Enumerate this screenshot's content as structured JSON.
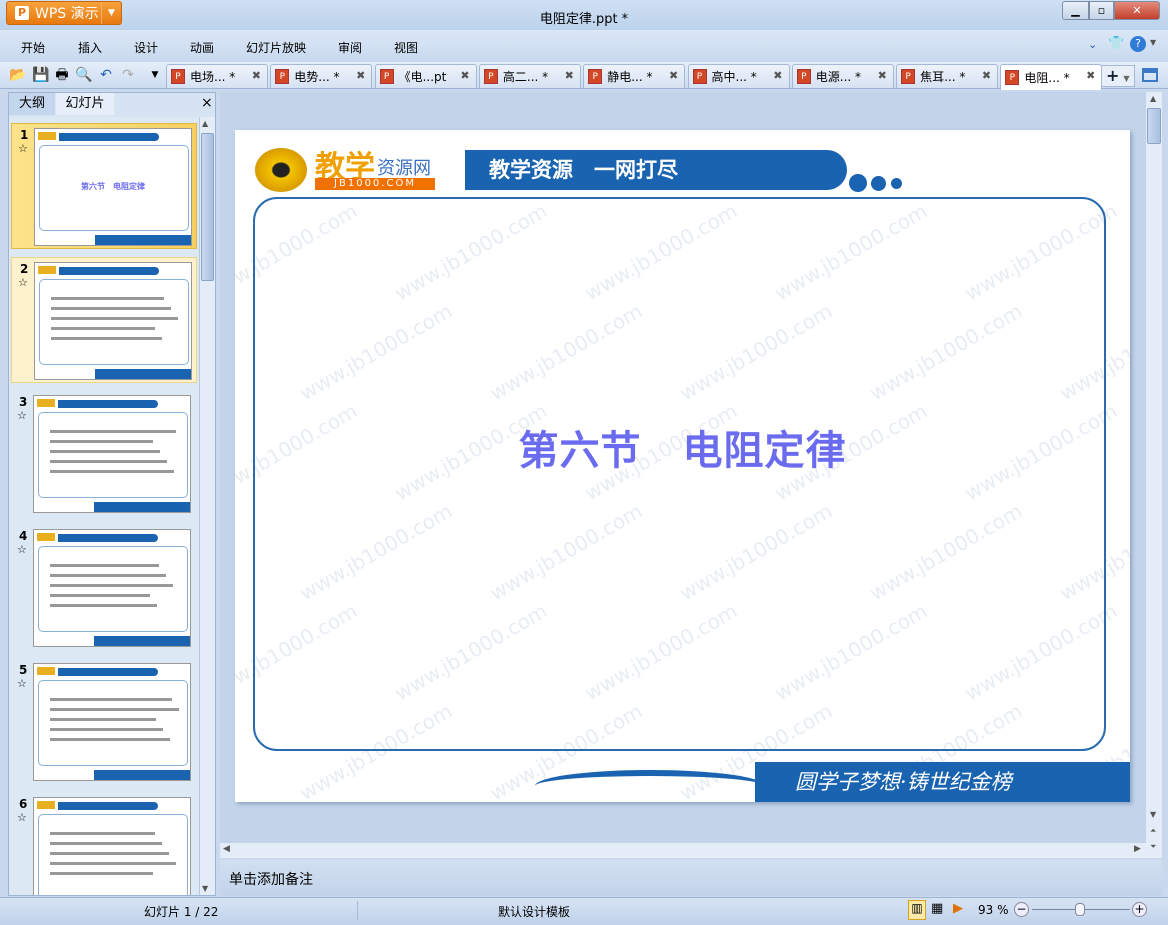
{
  "app": {
    "name": "WPS 演示",
    "window_title": "电阻定律.ppt *"
  },
  "menu": [
    "开始",
    "插入",
    "设计",
    "动画",
    "幻灯片放映",
    "审阅",
    "视图"
  ],
  "tabs": [
    {
      "label": "电场... *"
    },
    {
      "label": "电势... *"
    },
    {
      "label": "《电...pt"
    },
    {
      "label": "高二... *"
    },
    {
      "label": "静电... *"
    },
    {
      "label": "高中... *"
    },
    {
      "label": "电源... *"
    },
    {
      "label": "焦耳... *"
    },
    {
      "label": "电阻... *",
      "active": true
    }
  ],
  "panel": {
    "tab_outline": "大纲",
    "tab_slides": "幻灯片",
    "close": "×"
  },
  "thumbnails": [
    {
      "number": "1",
      "title": "第六节　电阻定律",
      "selected": true
    },
    {
      "number": "2"
    },
    {
      "number": "3"
    },
    {
      "number": "4"
    },
    {
      "number": "5"
    },
    {
      "number": "6"
    }
  ],
  "slide": {
    "logo_text": "教学",
    "logo_sub": "资源网",
    "logo_url": "JB1000.COM",
    "banner": "教学资源　一网打尽",
    "title": "第六节　电阻定律",
    "footer": "圆学子梦想·铸世纪金榜",
    "watermark": "www.jb1000.com"
  },
  "notes": {
    "placeholder": "单击添加备注"
  },
  "status": {
    "slide_count": "幻灯片 1 / 22",
    "template": "默认设计模板",
    "zoom": "93 %",
    "zoom_percent": 93
  },
  "colors": {
    "accent": "#1a63b0",
    "title": "#6b6bef",
    "app_orange": "#e8780f"
  }
}
